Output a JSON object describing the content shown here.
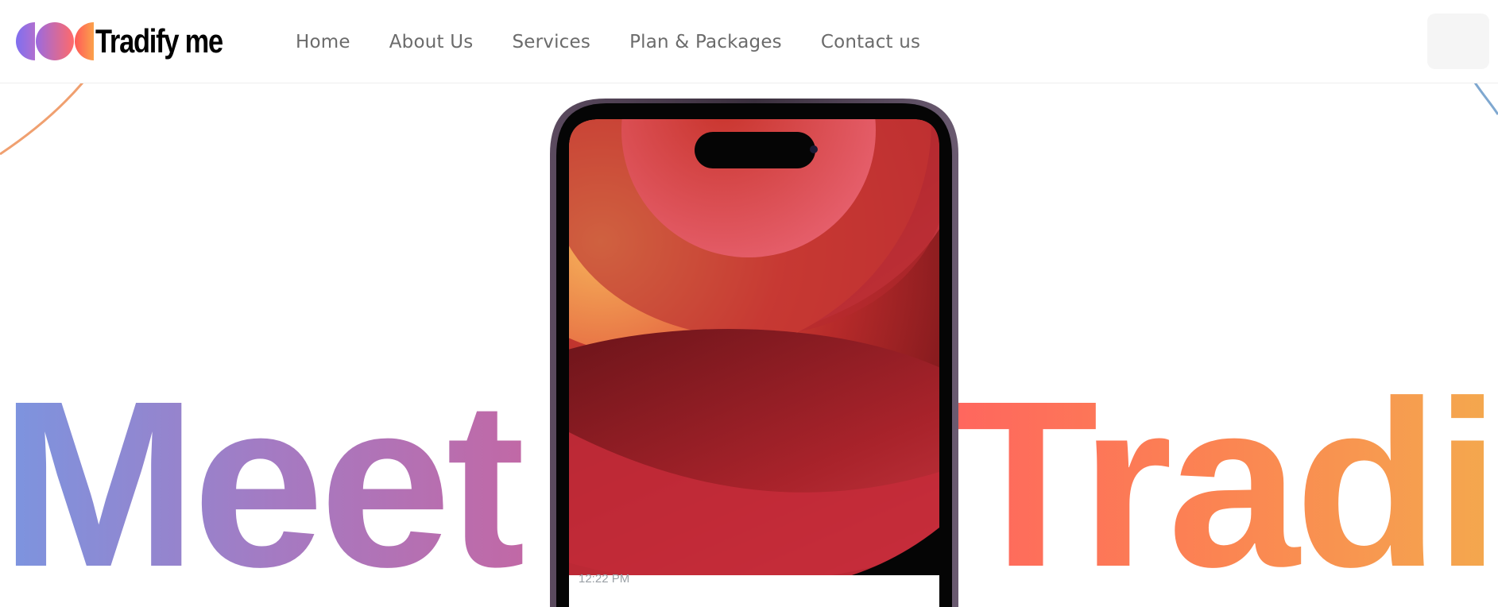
{
  "brand": {
    "name": "Tradify me",
    "colors": [
      "#7e6ee0",
      "#c86ab2",
      "#ff6a58",
      "#f6a24a"
    ]
  },
  "nav": {
    "items": [
      {
        "label": "Home"
      },
      {
        "label": "About Us"
      },
      {
        "label": "Services"
      },
      {
        "label": "Plan & Packages"
      },
      {
        "label": "Contact us"
      }
    ]
  },
  "hero": {
    "word_left": "Meet",
    "word_right": "Tradify",
    "gradient_left": [
      "#7b95e0",
      "#a875bf",
      "#c566a2"
    ],
    "gradient_right": [
      "#ff665e",
      "#fb8552",
      "#f4a94e"
    ]
  },
  "phone": {
    "time": "12:22 PM",
    "icon": "smartphone-mockup"
  }
}
